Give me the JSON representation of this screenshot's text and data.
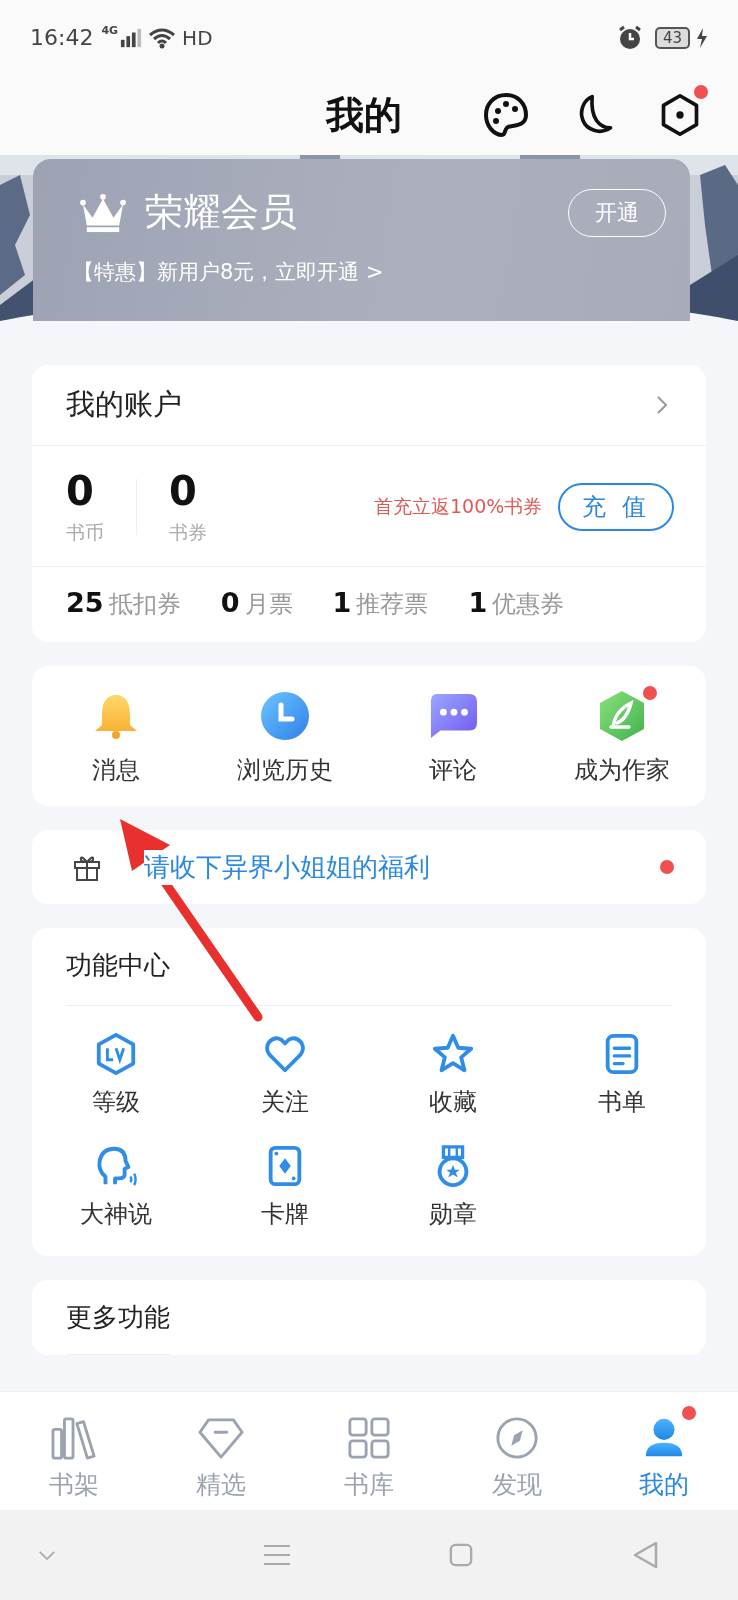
{
  "status_bar": {
    "time": "16:42",
    "network": "4G",
    "hd": "HD",
    "battery": "43"
  },
  "header": {
    "title": "我的",
    "settings_badge": true
  },
  "vip": {
    "title": "荣耀会员",
    "subtitle": "【特惠】新用户8元，立即开通 >",
    "button": "开通"
  },
  "account": {
    "title": "我的账户",
    "balances": [
      {
        "value": "0",
        "label": "书币"
      },
      {
        "value": "0",
        "label": "书券"
      }
    ],
    "promo": "首充立返100%书券",
    "recharge_button": "充 值",
    "tickets": [
      {
        "count": "25",
        "name": "抵扣券"
      },
      {
        "count": "0",
        "name": "月票"
      },
      {
        "count": "1",
        "name": "推荐票"
      },
      {
        "count": "1",
        "name": "优惠券"
      }
    ]
  },
  "shortcuts": [
    {
      "label": "消息",
      "badge": false
    },
    {
      "label": "浏览历史",
      "badge": false
    },
    {
      "label": "评论",
      "badge": false
    },
    {
      "label": "成为作家",
      "badge": true
    }
  ],
  "gift_banner": {
    "text": "请收下异界小姐姐的福利",
    "badge": true
  },
  "function_center": {
    "title": "功能中心",
    "items": [
      {
        "label": "等级"
      },
      {
        "label": "关注"
      },
      {
        "label": "收藏"
      },
      {
        "label": "书单"
      },
      {
        "label": "大神说"
      },
      {
        "label": "卡牌"
      },
      {
        "label": "勋章"
      }
    ]
  },
  "more": {
    "title": "更多功能"
  },
  "tab_bar": [
    {
      "label": "书架",
      "selected": false,
      "badge": false
    },
    {
      "label": "精选",
      "selected": false,
      "badge": false
    },
    {
      "label": "书库",
      "selected": false,
      "badge": false
    },
    {
      "label": "发现",
      "selected": false,
      "badge": false
    },
    {
      "label": "我的",
      "selected": true,
      "badge": true
    }
  ]
}
